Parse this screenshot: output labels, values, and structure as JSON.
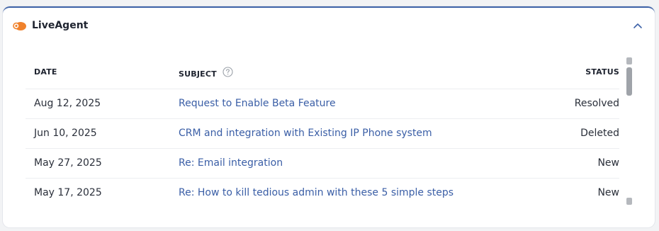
{
  "widget": {
    "title": "LiveAgent",
    "brand_icon": "liveagent-logo-icon",
    "collapse_icon": "chevron-up-icon",
    "accent_color": "#3e63a8",
    "link_color": "#3a5ea6",
    "logo_color": "#f0822c"
  },
  "table": {
    "columns": {
      "date": "DATE",
      "subject": "SUBJECT",
      "status": "STATUS"
    },
    "subject_help_icon": "question-circle-icon",
    "rows": [
      {
        "date": "Aug 12, 2025",
        "subject": "Request to Enable Beta Feature",
        "status": "Resolved"
      },
      {
        "date": "Jun 10, 2025",
        "subject": "CRM and integration with Existing IP Phone system",
        "status": "Deleted"
      },
      {
        "date": "May 27, 2025",
        "subject": "Re: Email integration",
        "status": "New"
      },
      {
        "date": "May 17, 2025",
        "subject": "Re: How to kill tedious admin with these 5 simple steps",
        "status": "New"
      }
    ]
  }
}
